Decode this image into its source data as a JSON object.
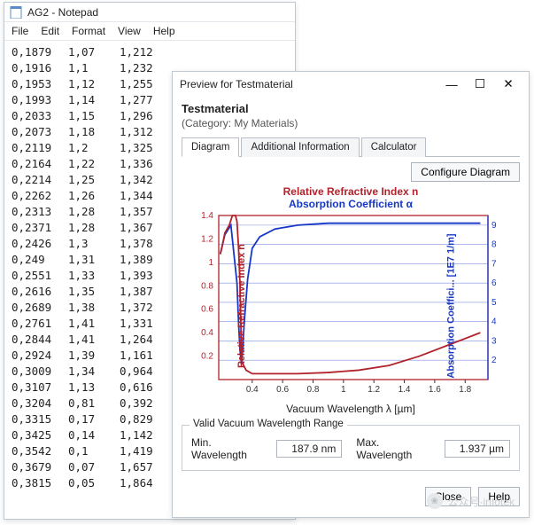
{
  "notepad": {
    "title": "AG2 - Notepad",
    "menus": [
      "File",
      "Edit",
      "Format",
      "View",
      "Help"
    ],
    "rows": [
      [
        "0,1879",
        "1,07",
        "1,212"
      ],
      [
        "0,1916",
        "1,1",
        "1,232"
      ],
      [
        "0,1953",
        "1,12",
        "1,255"
      ],
      [
        "0,1993",
        "1,14",
        "1,277"
      ],
      [
        "0,2033",
        "1,15",
        "1,296"
      ],
      [
        "0,2073",
        "1,18",
        "1,312"
      ],
      [
        "0,2119",
        "1,2",
        "1,325"
      ],
      [
        "0,2164",
        "1,22",
        "1,336"
      ],
      [
        "0,2214",
        "1,25",
        "1,342"
      ],
      [
        "0,2262",
        "1,26",
        "1,344"
      ],
      [
        "0,2313",
        "1,28",
        "1,357"
      ],
      [
        "0,2371",
        "1,28",
        "1,367"
      ],
      [
        "0,2426",
        "1,3",
        "1,378"
      ],
      [
        "0,249",
        "1,31",
        "1,389"
      ],
      [
        "0,2551",
        "1,33",
        "1,393"
      ],
      [
        "0,2616",
        "1,35",
        "1,387"
      ],
      [
        "0,2689",
        "1,38",
        "1,372"
      ],
      [
        "0,2761",
        "1,41",
        "1,331"
      ],
      [
        "0,2844",
        "1,41",
        "1,264"
      ],
      [
        "0,2924",
        "1,39",
        "1,161"
      ],
      [
        "0,3009",
        "1,34",
        "0,964"
      ],
      [
        "0,3107",
        "1,13",
        "0,616"
      ],
      [
        "0,3204",
        "0,81",
        "0,392"
      ],
      [
        "0,3315",
        "0,17",
        "0,829"
      ],
      [
        "0,3425",
        "0,14",
        "1,142"
      ],
      [
        "0,3542",
        "0,1",
        "1,419"
      ],
      [
        "0,3679",
        "0,07",
        "1,657"
      ],
      [
        "0,3815",
        "0,05",
        "1,864"
      ]
    ]
  },
  "preview": {
    "title": "Preview for Testmaterial",
    "material": "Testmaterial",
    "category": "(Category: My Materials)",
    "tabs": [
      "Diagram",
      "Additional Information",
      "Calculator"
    ],
    "active_tab": 0,
    "configure_btn": "Configure Diagram",
    "legend_n": "Relative Refractive Index n",
    "legend_a": "Absorption Coefficient α",
    "ylabel_left": "Relative Refractive Index n",
    "ylabel_right": "Absorption Coeffici... [1E7 1/m]",
    "xlabel": "Vacuum Wavelength λ [µm]",
    "range_title": "Valid Vacuum Wavelength Range",
    "min_label": "Min. Wavelength",
    "min_value": "187.9 nm",
    "max_label": "Max. Wavelength",
    "max_value": "1.937 µm",
    "close_btn": "Close",
    "help_btn": "Help"
  },
  "watermark": "公众号·infotek",
  "chart_data": {
    "type": "line",
    "xlabel": "Vacuum Wavelength λ [µm]",
    "x_ticks": [
      0.4,
      0.6,
      0.8,
      1.0,
      1.2,
      1.4,
      1.6,
      1.8
    ],
    "xlim": [
      0.18,
      1.95
    ],
    "series": [
      {
        "name": "Relative Refractive Index n",
        "color": "#b2222b",
        "ylabel": "Relative Refractive Index n",
        "ylim": [
          0,
          1.4
        ],
        "y_ticks": [
          0.2,
          0.4,
          0.6,
          0.8,
          1.0,
          1.2,
          1.4
        ],
        "x": [
          0.19,
          0.2,
          0.22,
          0.25,
          0.27,
          0.29,
          0.3,
          0.31,
          0.32,
          0.33,
          0.34,
          0.36,
          0.4,
          0.5,
          0.7,
          0.9,
          1.1,
          1.3,
          1.5,
          1.7,
          1.9
        ],
        "y": [
          1.07,
          1.12,
          1.25,
          1.32,
          1.4,
          1.4,
          1.35,
          1.13,
          0.81,
          0.17,
          0.13,
          0.08,
          0.05,
          0.05,
          0.05,
          0.06,
          0.08,
          0.12,
          0.2,
          0.3,
          0.4
        ]
      },
      {
        "name": "Absorption Coefficient α",
        "color": "#1737c7",
        "ylabel": "Absorption Coeffici... [1E7 1/m]",
        "ylim": [
          1,
          9.5
        ],
        "y_ticks": [
          2,
          3,
          4,
          5,
          6,
          7,
          8,
          9
        ],
        "x": [
          0.19,
          0.22,
          0.26,
          0.3,
          0.31,
          0.32,
          0.33,
          0.35,
          0.37,
          0.4,
          0.45,
          0.55,
          0.7,
          0.9,
          1.1,
          1.3,
          1.5,
          1.7,
          1.9
        ],
        "y": [
          7.5,
          8.5,
          9.0,
          6.0,
          4.0,
          2.5,
          1.8,
          4.2,
          6.2,
          7.8,
          8.4,
          8.8,
          9.0,
          9.1,
          9.1,
          9.1,
          9.1,
          9.1,
          9.1
        ]
      }
    ]
  }
}
